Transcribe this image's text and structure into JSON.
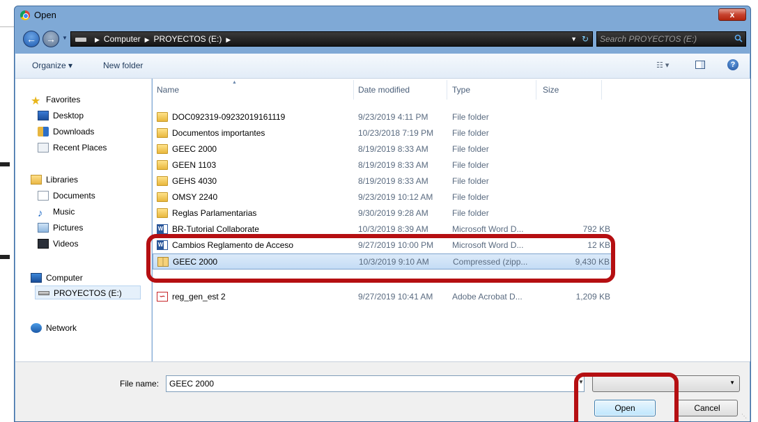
{
  "window": {
    "title": "Open",
    "close_glyph": "x"
  },
  "navbar": {
    "back_glyph": "←",
    "forward_glyph": "→",
    "breadcrumb": [
      "Computer",
      "PROYECTOS (E:)"
    ],
    "search_placeholder": "Search PROYECTOS (E:)"
  },
  "toolbar": {
    "organize_label": "Organize ▾",
    "new_folder_label": "New folder",
    "views_label": "☷ ▾",
    "help_glyph": "?"
  },
  "sidebar": {
    "favorites_header": "Favorites",
    "favorites": [
      "Desktop",
      "Downloads",
      "Recent Places"
    ],
    "libraries_header": "Libraries",
    "libraries": [
      "Documents",
      "Music",
      "Pictures",
      "Videos"
    ],
    "computer_header": "Computer",
    "drives": [
      "PROYECTOS (E:)"
    ],
    "network_header": "Network"
  },
  "columns": {
    "name": "Name",
    "date": "Date modified",
    "type": "Type",
    "size": "Size"
  },
  "files": [
    {
      "name": "DOC092319-09232019161119",
      "date": "9/23/2019 4:11 PM",
      "type": "File folder",
      "size": "",
      "icon": "folder-icon"
    },
    {
      "name": "Documentos importantes",
      "date": "10/23/2018 7:19 PM",
      "type": "File folder",
      "size": "",
      "icon": "folder-icon"
    },
    {
      "name": "GEEC 2000",
      "date": "8/19/2019 8:33 AM",
      "type": "File folder",
      "size": "",
      "icon": "folder-icon"
    },
    {
      "name": "GEEN 1103",
      "date": "8/19/2019 8:33 AM",
      "type": "File folder",
      "size": "",
      "icon": "folder-icon"
    },
    {
      "name": "GEHS 4030",
      "date": "8/19/2019 8:33 AM",
      "type": "File folder",
      "size": "",
      "icon": "folder-icon"
    },
    {
      "name": "OMSY 2240",
      "date": "9/23/2019 10:12 AM",
      "type": "File folder",
      "size": "",
      "icon": "folder-icon"
    },
    {
      "name": "Reglas Parlamentarias",
      "date": "9/30/2019 9:28 AM",
      "type": "File folder",
      "size": "",
      "icon": "folder-icon"
    },
    {
      "name": "BR-Tutorial Collaborate",
      "date": "10/3/2019 8:39 AM",
      "type": "Microsoft Word D...",
      "size": "792 KB",
      "icon": "word-doc-icon"
    },
    {
      "name": "Cambios Reglamento de Acceso",
      "date": "9/27/2019 10:00 PM",
      "type": "Microsoft Word D...",
      "size": "12 KB",
      "icon": "word-doc-icon"
    },
    {
      "name": "GEEC 2000",
      "date": "10/3/2019 9:10 AM",
      "type": "Compressed (zipp...",
      "size": "9,430 KB",
      "icon": "zip-folder-icon"
    },
    {
      "name": "reg_gen_est 2",
      "date": "9/27/2019 10:41 AM",
      "type": "Adobe Acrobat D...",
      "size": "1,209 KB",
      "icon": "pdf-icon"
    }
  ],
  "selected_file_index": 9,
  "footer": {
    "filename_label": "File name:",
    "filename_value": "GEEC 2000",
    "filetype_value": "",
    "open_label": "Open",
    "cancel_label": "Cancel"
  },
  "colors": {
    "callout": "#b50f12",
    "frame": "#7fa9d6",
    "selection": "#c4dcf5"
  }
}
